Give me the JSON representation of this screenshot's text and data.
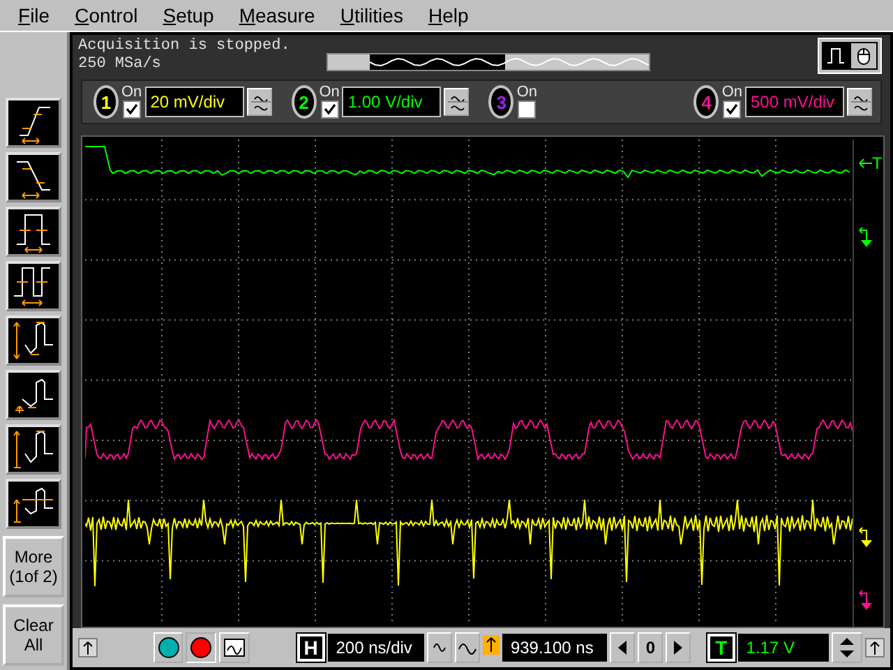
{
  "menu": [
    {
      "label": "File"
    },
    {
      "label": "Control"
    },
    {
      "label": "Setup"
    },
    {
      "label": "Measure"
    },
    {
      "label": "Utilities"
    },
    {
      "label": "Help"
    }
  ],
  "status": {
    "message": "Acquisition is stopped.",
    "sample_rate": "250 MSa/s"
  },
  "channels": [
    {
      "number": "1",
      "on_label": "On",
      "on": true,
      "scale": "20 mV/div",
      "color": "#ffff00"
    },
    {
      "number": "2",
      "on_label": "On",
      "on": true,
      "scale": "1.00 V/div",
      "color": "#00ff00"
    },
    {
      "number": "3",
      "on_label": "On",
      "on": false,
      "color": "#a020f0"
    },
    {
      "number": "4",
      "on_label": "On",
      "on": true,
      "scale": "500 mV/div",
      "color": "#ff1090"
    }
  ],
  "measure_tools": [
    {
      "kind": "rise"
    },
    {
      "kind": "fall"
    },
    {
      "kind": "width"
    },
    {
      "kind": "period"
    },
    {
      "kind": "peak"
    },
    {
      "kind": "base"
    },
    {
      "kind": "top"
    },
    {
      "kind": "average"
    }
  ],
  "side_buttons": [
    {
      "label": "More\n(1of 2)"
    },
    {
      "label": "Clear\nAll"
    }
  ],
  "trigger_marker": {
    "label": "T"
  },
  "bottom": {
    "horizontal_label": "H",
    "time_scale": "200 ns/div",
    "delay": "939.100 ns",
    "delay_zero": "0",
    "trigger_label": "T",
    "trigger_level": "1.17 V"
  }
}
